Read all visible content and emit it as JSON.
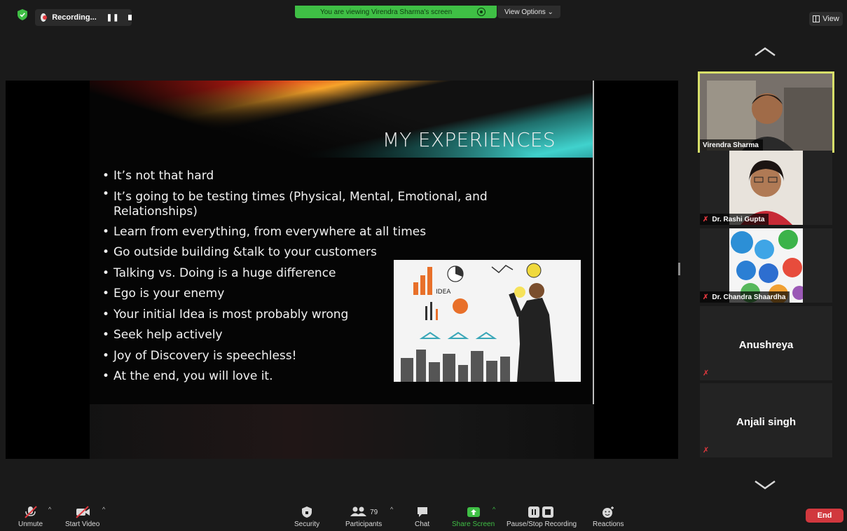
{
  "top": {
    "recording_label": "Recording...",
    "viewing_banner": "You are viewing Virendra Sharma's screen",
    "view_options": "View Options ⌄",
    "view_label": "View"
  },
  "slide": {
    "title": "MY EXPERIENCES",
    "bullets": [
      "It’s not that hard",
      "It’s going to be testing times (Physical, Mental, Emotional, and Relationships)",
      "Learn from everything, from everywhere at all times",
      "Go outside building &talk to your customers",
      "Talking vs. Doing is a huge difference",
      "Ego is your enemy",
      "Your initial Idea is most probably wrong",
      "Seek help actively",
      "Joy of Discovery is speechless!",
      "At the end, you will love it."
    ]
  },
  "participants": [
    {
      "name": "Virendra Sharma"
    },
    {
      "name": "Dr. Rashi Gupta"
    },
    {
      "name": "Dr. Chandra Shaardha"
    },
    {
      "name": "Anushreya"
    },
    {
      "name": "Anjali singh"
    }
  ],
  "toolbar": {
    "unmute": "Unmute",
    "start_video": "Start Video",
    "security": "Security",
    "participants": "Participants",
    "participant_count": "79",
    "chat": "Chat",
    "share_screen": "Share Screen",
    "pause_stop_recording": "Pause/Stop Recording",
    "reactions": "Reactions",
    "end": "End"
  },
  "colors": {
    "green": "#3fbf45",
    "end_red": "#d1383e",
    "active_speaker_border": "#d7df6a"
  }
}
